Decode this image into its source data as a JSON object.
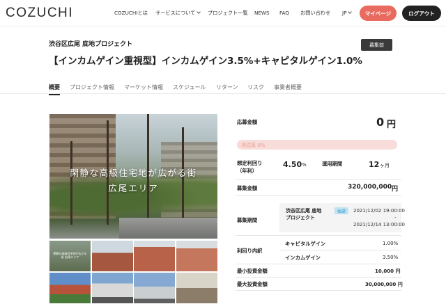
{
  "header": {
    "logo": "COZUCHI",
    "nav": [
      "COZUCHIとは",
      "サービスについて",
      "プロジェクト一覧",
      "NEWS",
      "FAQ",
      "お問い合わせ"
    ],
    "language": "JP",
    "mypage_label": "マイページ",
    "logout_label": "ログアウト"
  },
  "project": {
    "subtitle": "渋谷区広尾 底地プロジェクト",
    "title": "【インカムゲイン重視型】インカムゲイン3.5%+キャピタルゲイン1.0%",
    "status": "募集前"
  },
  "tabs": [
    "概要",
    "プロジェクト情報",
    "マーケット情報",
    "スケジュール",
    "リターン",
    "リスク",
    "事業者概要"
  ],
  "hero": {
    "line1": "閑静な高級住宅地が広がる街",
    "line2": "広尾エリア",
    "thumb_caption": "閑静な高級住宅地が広がる街 広尾エリア"
  },
  "summary": {
    "applied_label": "応募金額",
    "applied_value": "0",
    "applied_unit": "円",
    "progress_text": "達成率 0%",
    "progress_fraction": 0,
    "yield_label": "想定利回り",
    "yield_sublabel": "（年利）",
    "yield_value": "4.50",
    "yield_unit": "%",
    "period_label": "運用期間",
    "period_value": "12",
    "period_unit": "ヶ月",
    "amount_label": "募集金額",
    "amount_value": "320,000,000",
    "amount_unit": "円",
    "recruit_label": "募集期間",
    "recruit_name_line1": "渋谷区広尾 底地",
    "recruit_name_line2": "プロジェクト",
    "method": "抽選",
    "date_start": "2021/12/02 19:00:00",
    "date_sep": "-",
    "date_end": "2021/12/14 13:00:00",
    "breakdown_label": "利回り内訳",
    "capital_label": "キャピタルゲイン",
    "capital_value": "1.00%",
    "income_label": "インカムゲイン",
    "income_value": "3.50%",
    "min_label": "最小投資金額",
    "min_value": "10,000 円",
    "max_label": "最大投資金額",
    "max_value": "30,000,000 円"
  }
}
